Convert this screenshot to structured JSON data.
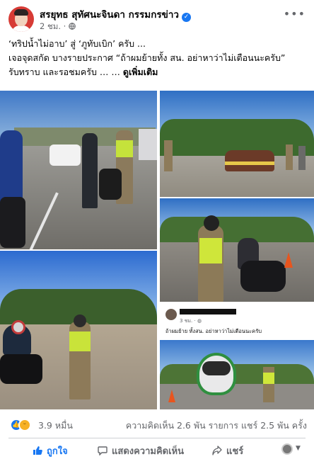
{
  "post": {
    "author": "สรยุทธ สุทัศนะจินดา กรรมกรข่าว",
    "time": "2 ชม.",
    "meta_separator": "·",
    "privacy_icon": "globe-icon",
    "verified_icon": "verified-badge-icon",
    "more_icon": "more-dots-icon",
    "caption_lines": [
      "‘ทริปน้ำไม่อาบ’ สู่ ‘ภูทับเบิก’ ครับ ...",
      "เจอจุดสกัด บางรายประกาศ “ถ้าผมย้ายทั้ง สน. อย่าหาว่าไม่เตือนนะครับ”",
      "รับทราบ และรอชมครับ … …"
    ],
    "see_more": "ดูเพิ่มเติม"
  },
  "photos": [
    {
      "description_icon": "photo-motorcycle-checkpoint"
    },
    {
      "description_icon": "photo-police-checkpoint-car"
    },
    {
      "description_icon": "photo-officer-writing-ticket"
    },
    {
      "description_icon": "photo-officer-with-rider"
    },
    {
      "description_icon": "photo-screenshot-social-post"
    }
  ],
  "embedded_post": {
    "time": "3 ชม.",
    "text": "ถ้าผมย้าย ทั้งสน. อย่าหาว่าไม่เตือนนะครับ"
  },
  "reactions": {
    "count": "3.9 หมื่น",
    "icons": [
      "like-icon",
      "haha-icon"
    ],
    "comments": "ความคิดเห็น 2.6 พัน รายการ",
    "shares": "แชร์ 2.5 พัน ครั้ง"
  },
  "actions": {
    "like": "ถูกใจ",
    "comment": "แสดงความคิดเห็น",
    "share": "แชร์"
  },
  "colors": {
    "accent": "#1877f2",
    "secondary_text": "#65676b",
    "divider": "#ced0d4",
    "haha": "#f7b125"
  }
}
